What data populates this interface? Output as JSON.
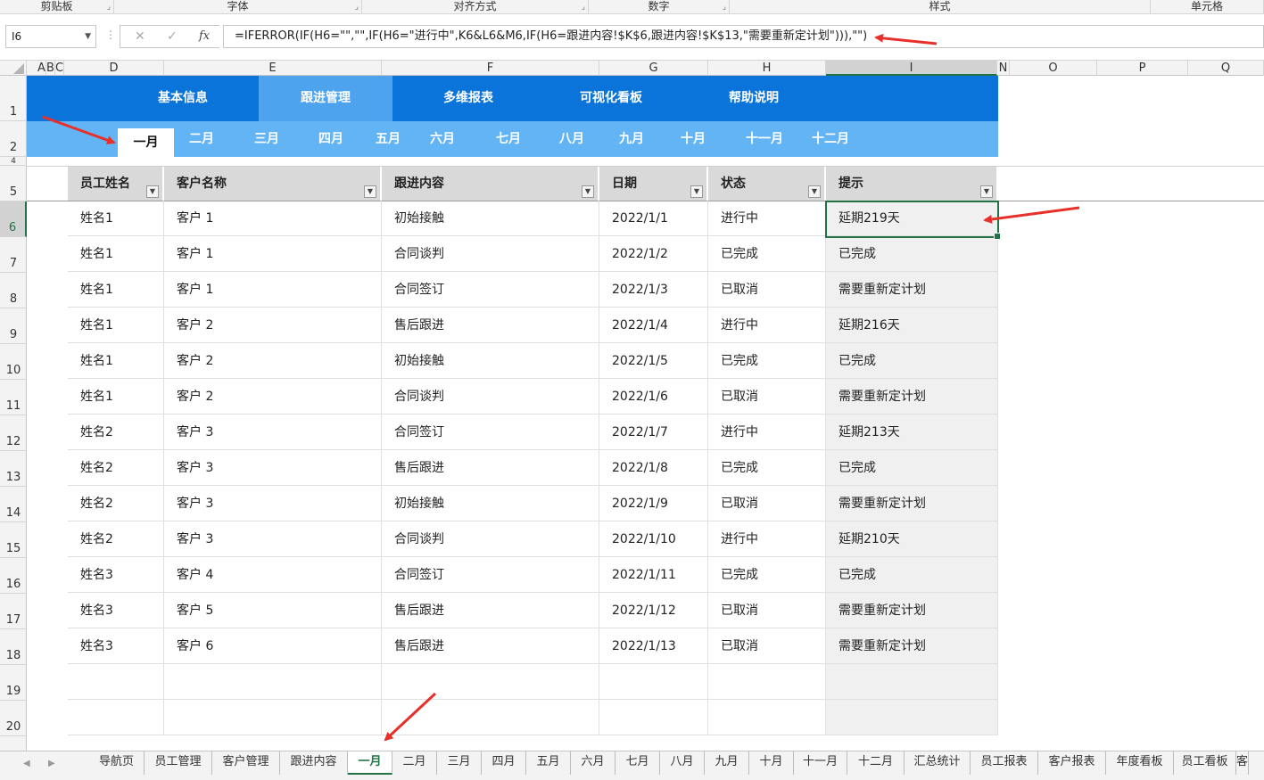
{
  "ribbon": {
    "groups": [
      "剪贴板",
      "字体",
      "对齐方式",
      "数字",
      "样式",
      "单元格"
    ]
  },
  "formula_bar": {
    "name_box": "I6",
    "fx": "fx",
    "formula": "=IFERROR(IF(H6=\"\",\"\",IF(H6=\"进行中\",K6&L6&M6,IF(H6=跟进内容!$K$6,跟进内容!$K$13,\"需要重新定计划\"))),\"\")"
  },
  "columns": [
    "A",
    "B",
    "C",
    "D",
    "E",
    "F",
    "G",
    "H",
    "I",
    "N",
    "O",
    "P",
    "Q"
  ],
  "rows": [
    "1",
    "2",
    "4",
    "5",
    "6",
    "7",
    "8",
    "9",
    "10",
    "11",
    "12",
    "13",
    "14",
    "15",
    "16",
    "17",
    "18",
    "19",
    "20"
  ],
  "nav": {
    "items": [
      "基本信息",
      "跟进管理",
      "多维报表",
      "可视化看板",
      "帮助说明"
    ],
    "active": "跟进管理"
  },
  "months": {
    "items": [
      "一月",
      "二月",
      "三月",
      "四月",
      "五月",
      "六月",
      "七月",
      "八月",
      "九月",
      "十月",
      "十一月",
      "十二月"
    ],
    "active": "一月"
  },
  "table": {
    "headers": [
      "员工姓名",
      "客户名称",
      "跟进内容",
      "日期",
      "状态",
      "提示"
    ],
    "rows": [
      [
        "姓名1",
        "客户 1",
        "初始接触",
        "2022/1/1",
        "进行中",
        "延期219天"
      ],
      [
        "姓名1",
        "客户 1",
        "合同谈判",
        "2022/1/2",
        "已完成",
        "已完成"
      ],
      [
        "姓名1",
        "客户 1",
        "合同签订",
        "2022/1/3",
        "已取消",
        "需要重新定计划"
      ],
      [
        "姓名1",
        "客户 2",
        "售后跟进",
        "2022/1/4",
        "进行中",
        "延期216天"
      ],
      [
        "姓名1",
        "客户 2",
        "初始接触",
        "2022/1/5",
        "已完成",
        "已完成"
      ],
      [
        "姓名1",
        "客户 2",
        "合同谈判",
        "2022/1/6",
        "已取消",
        "需要重新定计划"
      ],
      [
        "姓名2",
        "客户 3",
        "合同签订",
        "2022/1/7",
        "进行中",
        "延期213天"
      ],
      [
        "姓名2",
        "客户 3",
        "售后跟进",
        "2022/1/8",
        "已完成",
        "已完成"
      ],
      [
        "姓名2",
        "客户 3",
        "初始接触",
        "2022/1/9",
        "已取消",
        "需要重新定计划"
      ],
      [
        "姓名2",
        "客户 3",
        "合同谈判",
        "2022/1/10",
        "进行中",
        "延期210天"
      ],
      [
        "姓名3",
        "客户 4",
        "合同签订",
        "2022/1/11",
        "已完成",
        "已完成"
      ],
      [
        "姓名3",
        "客户 5",
        "售后跟进",
        "2022/1/12",
        "已取消",
        "需要重新定计划"
      ],
      [
        "姓名3",
        "客户 6",
        "售后跟进",
        "2022/1/13",
        "已取消",
        "需要重新定计划"
      ],
      [
        "",
        "",
        "",
        "",
        "",
        ""
      ],
      [
        "",
        "",
        "",
        "",
        "",
        ""
      ]
    ]
  },
  "sheet_tabs": {
    "items": [
      "导航页",
      "员工管理",
      "客户管理",
      "跟进内容",
      "一月",
      "二月",
      "三月",
      "四月",
      "五月",
      "六月",
      "七月",
      "八月",
      "九月",
      "十月",
      "十一月",
      "十二月",
      "汇总统计",
      "员工报表",
      "客户报表",
      "年度看板",
      "员工看板",
      "客"
    ],
    "active": "一月"
  },
  "colors": {
    "nav_bg": "#0a74da",
    "nav_active": "#4da3ee",
    "month_bg": "#62b4f5",
    "excel_green": "#217346",
    "arrow_red": "#e8302a"
  }
}
